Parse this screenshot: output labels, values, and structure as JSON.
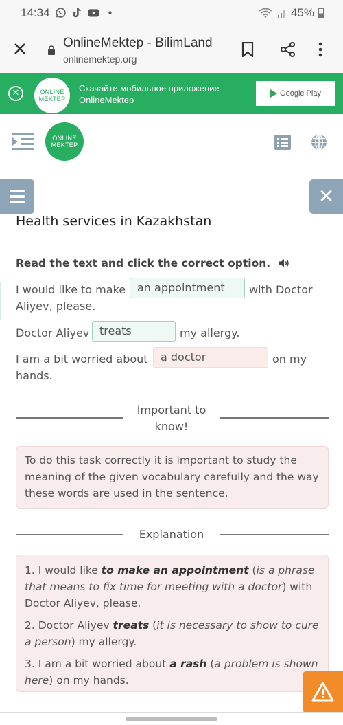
{
  "status_bar": {
    "time": "14:34",
    "notification_icons": [
      "whatsapp-icon",
      "tiktok-icon",
      "youtube-icon",
      "dot-icon"
    ],
    "battery": "45%"
  },
  "browser": {
    "title": "OnlineMektep - BilimLand",
    "url": "onlinemektep.org"
  },
  "app_banner": {
    "logo_line1": "ONLINE",
    "logo_line2": "MEKTEP",
    "text_line1": "Скачайте мобильное приложение",
    "text_line2": "OnlineMektep",
    "store_button": "Google Play",
    "brand_color": "#27ae60"
  },
  "header": {
    "logo_line1": "ONLINE",
    "logo_line2": "MEKTEP"
  },
  "side": {
    "close_glyph": "✕"
  },
  "page": {
    "title": "Health services in Kazakhstan",
    "instruction": "Read the text and click the correct option."
  },
  "sentences": [
    {
      "before": "I would like to make",
      "answer": "an appointment",
      "answer_state": "correct",
      "after_line1": "with Doctor",
      "after_line2": "Aliyev, please."
    },
    {
      "before": "Doctor Aliyev",
      "answer": "treats",
      "answer_state": "correct",
      "after_line1": "my allergy."
    },
    {
      "before": "I am a bit worried about",
      "answer": "a doctor",
      "answer_state": "wrong",
      "after_line1": "on my",
      "after_line2": "hands."
    }
  ],
  "important": {
    "heading_line1": "Important to",
    "heading_line2": "know!",
    "text": "To do this task correctly it is important to study the meaning of the given vocabulary carefully and the way these words are used in the sentence."
  },
  "explanation": {
    "heading": "Explanation",
    "items": [
      {
        "prefix": "1. I would like ",
        "key": "to make an appointment",
        "open": " (",
        "note": "is a phrase that means to fix time for meeting with a doctor",
        "close": ") with Doctor Aliyev, please."
      },
      {
        "prefix": "2. Doctor Aliyev ",
        "key": "treats",
        "open": " (",
        "note": "it is necessary to show to cure a person",
        "close": ") my allergy."
      },
      {
        "prefix": "3. I am a bit worried about ",
        "key": "a rash",
        "open": " (",
        "note": "a problem is shown here",
        "close": ") on my hands."
      }
    ]
  },
  "colors": {
    "correct_bg": "#eef8f4",
    "wrong_bg": "#fbecec",
    "side_button": "#8ea5b8",
    "warning": "#f28c28"
  }
}
